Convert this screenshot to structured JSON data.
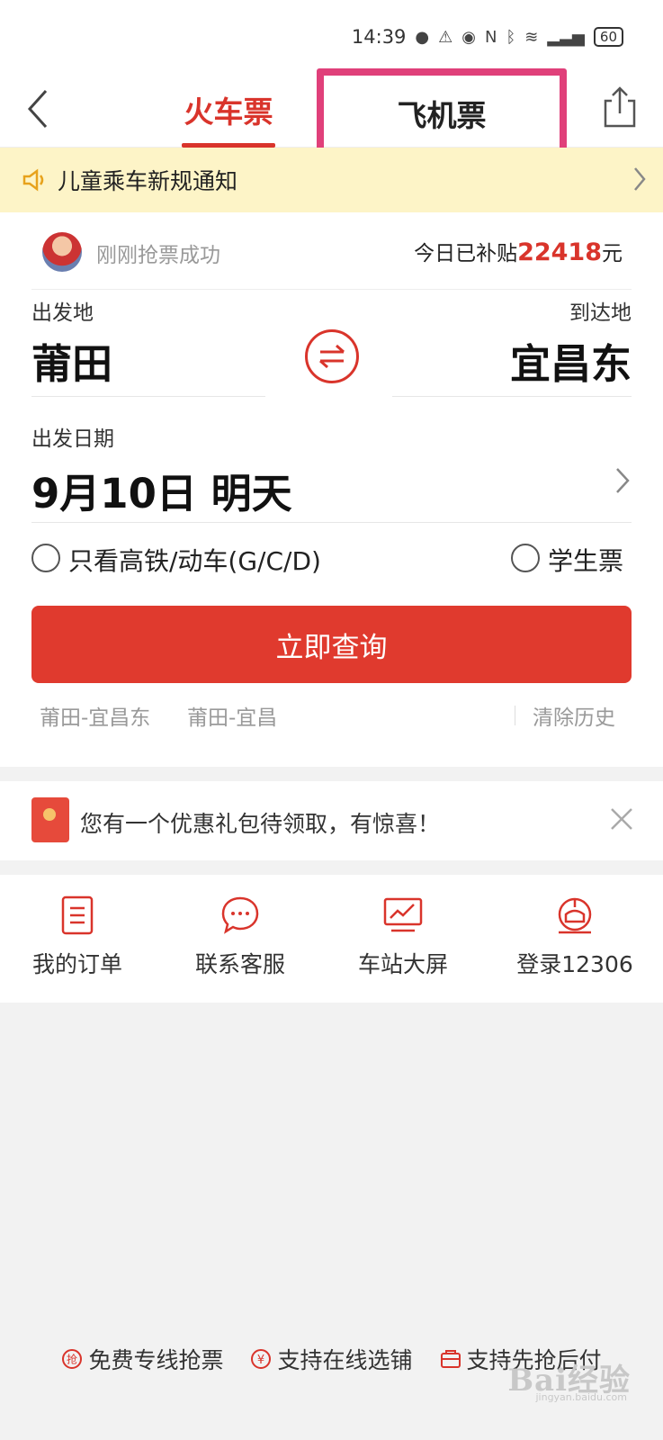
{
  "status_bar": {
    "time": "14:39",
    "battery": "60"
  },
  "nav": {
    "tab_train": "火车票",
    "tab_plane": "飞机票"
  },
  "notice": {
    "text": "儿童乘车新规通知"
  },
  "ticker": {
    "text": "刚刚抢票成功",
    "subsidy_prefix": "今日已补贴",
    "subsidy_amount": "22418",
    "subsidy_suffix": "元"
  },
  "search": {
    "from_label": "出发地",
    "from_city": "莆田",
    "to_label": "到达地",
    "to_city": "宜昌东",
    "date_label": "出发日期",
    "date_value": "9月10日 明天",
    "option_highspeed": "只看高铁/动车(G/C/D)",
    "option_student": "学生票",
    "search_button": "立即查询",
    "history": [
      "莆田-宜昌东",
      "莆田-宜昌"
    ],
    "clear_history": "清除历史"
  },
  "promo": {
    "text": "您有一个优惠礼包待领取，有惊喜！"
  },
  "shortcuts": [
    {
      "label": "我的订单",
      "icon": "order-icon"
    },
    {
      "label": "联系客服",
      "icon": "chat-icon"
    },
    {
      "label": "车站大屏",
      "icon": "screen-icon"
    },
    {
      "label": "登录12306",
      "icon": "train-logo-icon"
    }
  ],
  "footer": {
    "items": [
      "免费专线抢票",
      "支持在线选铺",
      "支持先抢后付"
    ],
    "icon_glyphs": [
      "抢",
      "¥"
    ]
  },
  "watermark": {
    "text": "Bai经验",
    "sub": "jingyan.baidu.com"
  },
  "colors": {
    "accent": "#d9342b",
    "highlight_box": "#e0407a",
    "notice_bg": "#fdf4c7"
  }
}
